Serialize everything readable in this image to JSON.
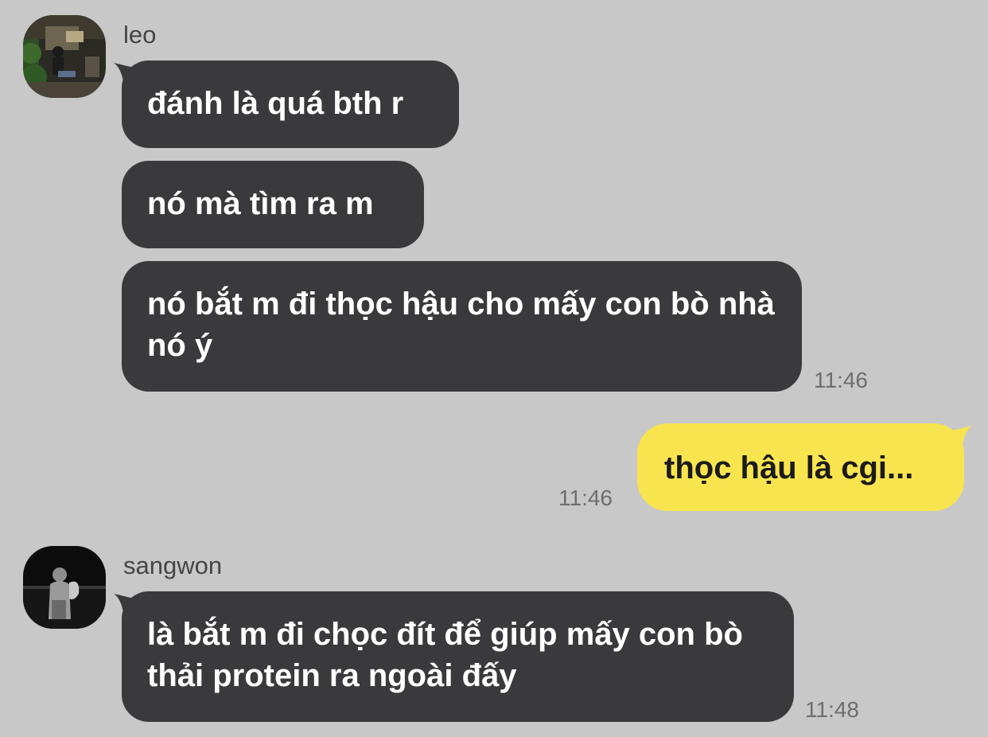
{
  "conversation": {
    "group1": {
      "sender": "leo",
      "messages": [
        {
          "text": "đánh là quá bth r"
        },
        {
          "text": "nó mà tìm ra m"
        },
        {
          "text": "nó bắt m đi thọc hậu cho mấy con bò nhà nó ý"
        }
      ],
      "time": "11:46"
    },
    "outgoing": {
      "messages": [
        {
          "text": "thọc hậu là cgi..."
        }
      ],
      "time": "11:46"
    },
    "group2": {
      "sender": "sangwon",
      "messages": [
        {
          "text": "là bắt m đi chọc đít để giúp mấy con bò thải protein ra ngoài đấy"
        }
      ],
      "time": "11:48"
    }
  },
  "colors": {
    "background": "#c8c8c8",
    "incoming_bubble": "#3a3a3c",
    "outgoing_bubble": "#f8e44e"
  }
}
